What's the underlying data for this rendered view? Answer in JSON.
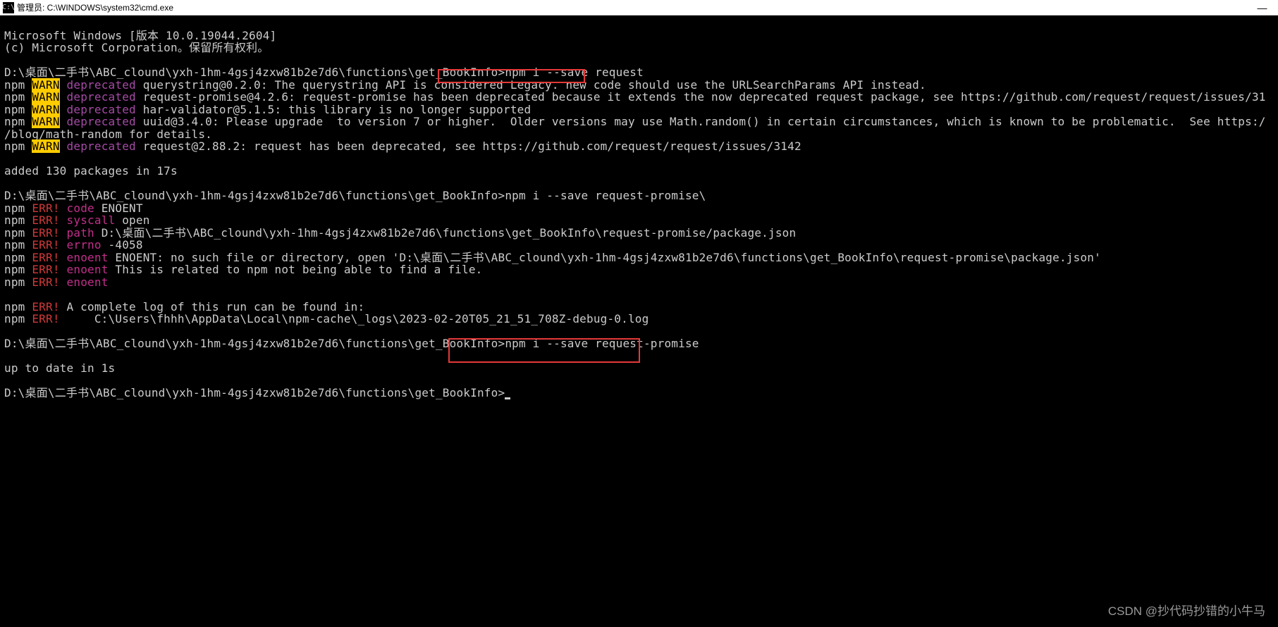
{
  "titlebar": {
    "icon_label": "C:\\",
    "title": "管理员: C:\\WINDOWS\\system32\\cmd.exe",
    "minimize": "—"
  },
  "terminal": {
    "line1": "Microsoft Windows [版本 10.0.19044.2604]",
    "line2": "(c) Microsoft Corporation。保留所有权利。",
    "prompt1_path": "D:\\桌面\\二手书\\ABC_clound\\yxh-1hm-4gsj4zxw81b2e7d6\\functions\\get_BookInfo>",
    "prompt1_cmd": "npm i --save request",
    "npm_label": "npm",
    "warn_label": "WARN",
    "deprecated_label": "deprecated",
    "warn1": " querystring@0.2.0: The querystring API is considered Legacy. new code should use the URLSearchParams API instead.",
    "warn2": " request-promise@4.2.6: request-promise has been deprecated because it extends the now deprecated request package, see https://github.com/request/request/issues/31",
    "warn3": " har-validator@5.1.5: this library is no longer supported",
    "warn4_a": " uuid@3.4.0: Please upgrade  to version 7 or higher.  Older versions may use Math.random() in certain circumstances, which is known to be problematic.  See https:/",
    "warn4_b": "/blog/math-random for details.",
    "warn5": " request@2.88.2: request has been deprecated, see https://github.com/request/request/issues/3142",
    "added": "added 130 packages in 17s",
    "prompt2_path": "D:\\桌面\\二手书\\ABC_clound\\yxh-1hm-4gsj4zxw81b2e7d6\\functions\\get_BookInfo>",
    "prompt2_cmd": "npm i --save request-promise\\",
    "err_label": "ERR!",
    "err_code_key": "code",
    "err_code_val": " ENOENT",
    "err_syscall_key": "syscall",
    "err_syscall_val": " open",
    "err_path_key": "path",
    "err_path_val": " D:\\桌面\\二手书\\ABC_clound\\yxh-1hm-4gsj4zxw81b2e7d6\\functions\\get_BookInfo\\request-promise/package.json",
    "err_errno_key": "errno",
    "err_errno_val": " -4058",
    "err_enoent_key": "enoent",
    "err_enoent1": " ENOENT: no such file or directory, open 'D:\\桌面\\二手书\\ABC_clound\\yxh-1hm-4gsj4zxw81b2e7d6\\functions\\get_BookInfo\\request-promise\\package.json'",
    "err_enoent2": " This is related to npm not being able to find a file.",
    "err_enoent3": "",
    "err_log1": " A complete log of this run can be found in:",
    "err_log2": "     C:\\Users\\fhhh\\AppData\\Local\\npm-cache\\_logs\\2023-02-20T05_21_51_708Z-debug-0.log",
    "prompt3_path": "D:\\桌面\\二手书\\ABC_clound\\yxh-1hm-4gsj4zxw81b2e7d6\\functions\\get_BookInfo>",
    "prompt3_cmd": "npm i --save request-promise",
    "uptodate": "up to date in 1s",
    "prompt4_path": "D:\\桌面\\二手书\\ABC_clound\\yxh-1hm-4gsj4zxw81b2e7d6\\functions\\get_BookInfo>"
  },
  "watermark": "CSDN @抄代码抄错的小牛马"
}
